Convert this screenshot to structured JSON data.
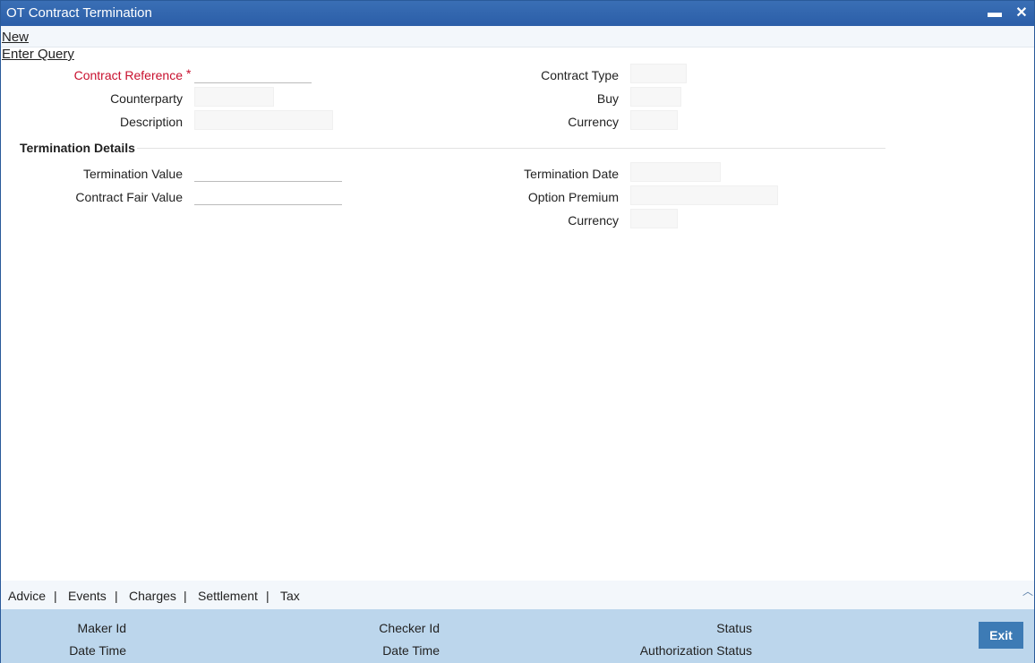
{
  "window": {
    "title": "OT Contract Termination",
    "minimize_glyph": "▬",
    "close_glyph": "✕"
  },
  "menu": {
    "new": "New",
    "enter_query": "Enter Query"
  },
  "contract": {
    "contract_reference": "Contract Reference",
    "required_mark": "*",
    "counterparty": "Counterparty",
    "description": "Description",
    "contract_type": "Contract Type",
    "buy": "Buy",
    "currency": "Currency"
  },
  "termination": {
    "section_title": "Termination Details",
    "termination_value": "Termination Value",
    "contract_fair_value": "Contract Fair Value",
    "termination_date": "Termination Date",
    "option_premium": "Option Premium",
    "currency": "Currency"
  },
  "tabs": [
    "Advice",
    "Events",
    "Charges",
    "Settlement",
    "Tax"
  ],
  "tab_separator": "|",
  "footer": {
    "maker_id": "Maker Id",
    "date_time": "Date Time",
    "checker_id": "Checker Id",
    "checker_date_time": "Date Time",
    "status": "Status",
    "authorization_status": "Authorization Status",
    "exit": "Exit"
  },
  "colors": {
    "titlebar": "#2b5ea8",
    "required": "#c8102e",
    "footer": "#bcd6ec",
    "exit_button": "#3d7bb5"
  }
}
